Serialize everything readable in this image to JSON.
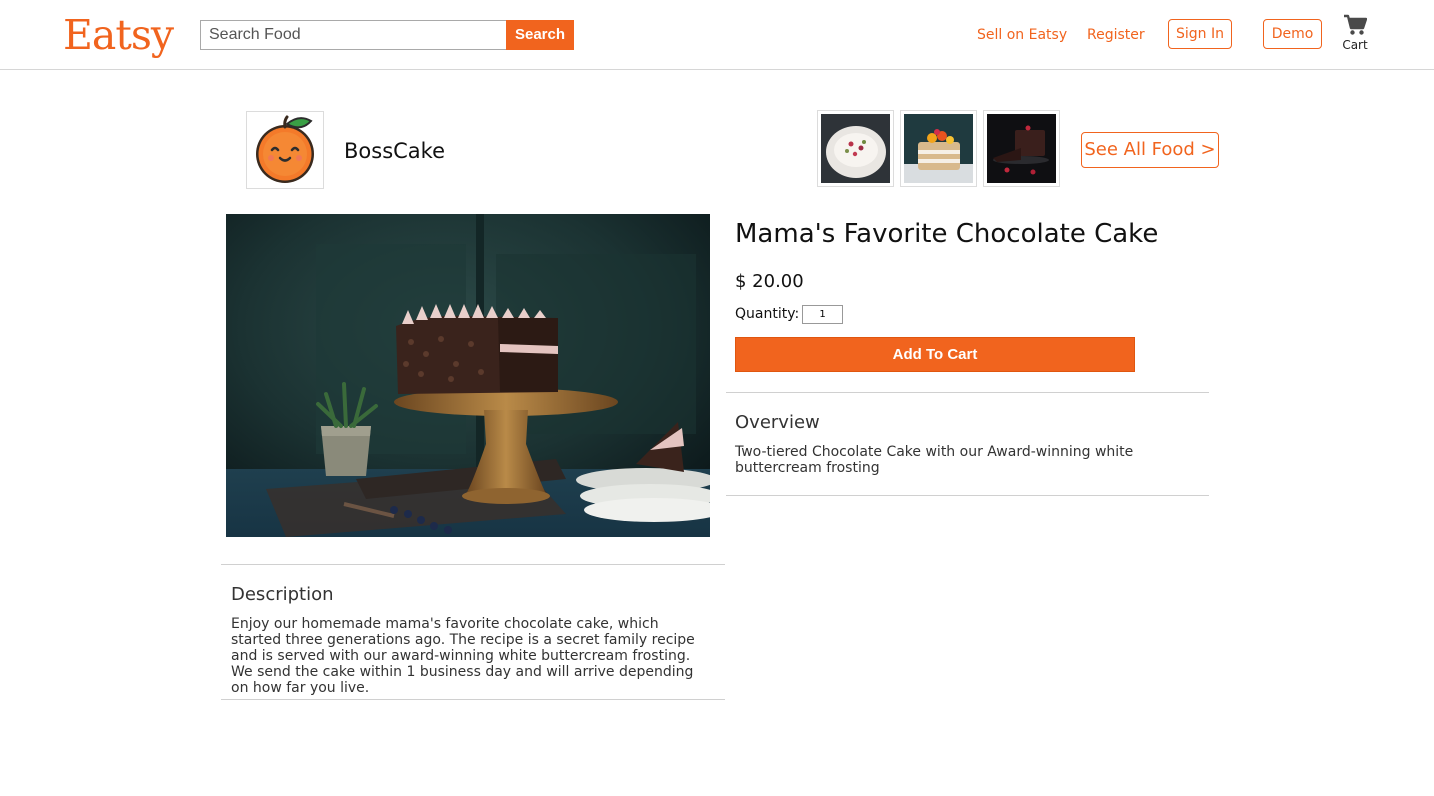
{
  "header": {
    "logo": "Eatsy",
    "search_placeholder": "Search Food",
    "search_button": "Search",
    "nav": {
      "sell": "Sell on Eatsy",
      "register": "Register",
      "sign_in": "Sign In",
      "demo": "Demo",
      "cart": "Cart"
    }
  },
  "shop": {
    "name": "BossCake",
    "see_all": "See All Food >"
  },
  "product": {
    "title": "Mama's Favorite Chocolate Cake",
    "price": "$ 20.00",
    "quantity_label": "Quantity:",
    "quantity_value": "1",
    "add_to_cart": "Add To Cart",
    "overview": {
      "heading": "Overview",
      "text": "Two-tiered Chocolate Cake with our Award-winning white buttercream frosting"
    },
    "description": {
      "heading": "Description",
      "text": "Enjoy our homemade mama's favorite chocolate cake, which started three generations ago. The recipe is a secret family recipe and is served with our award-winning white buttercream frosting. We send the cake within 1 business day and will arrive depending on how far you live."
    }
  },
  "colors": {
    "accent": "#f1641e"
  }
}
